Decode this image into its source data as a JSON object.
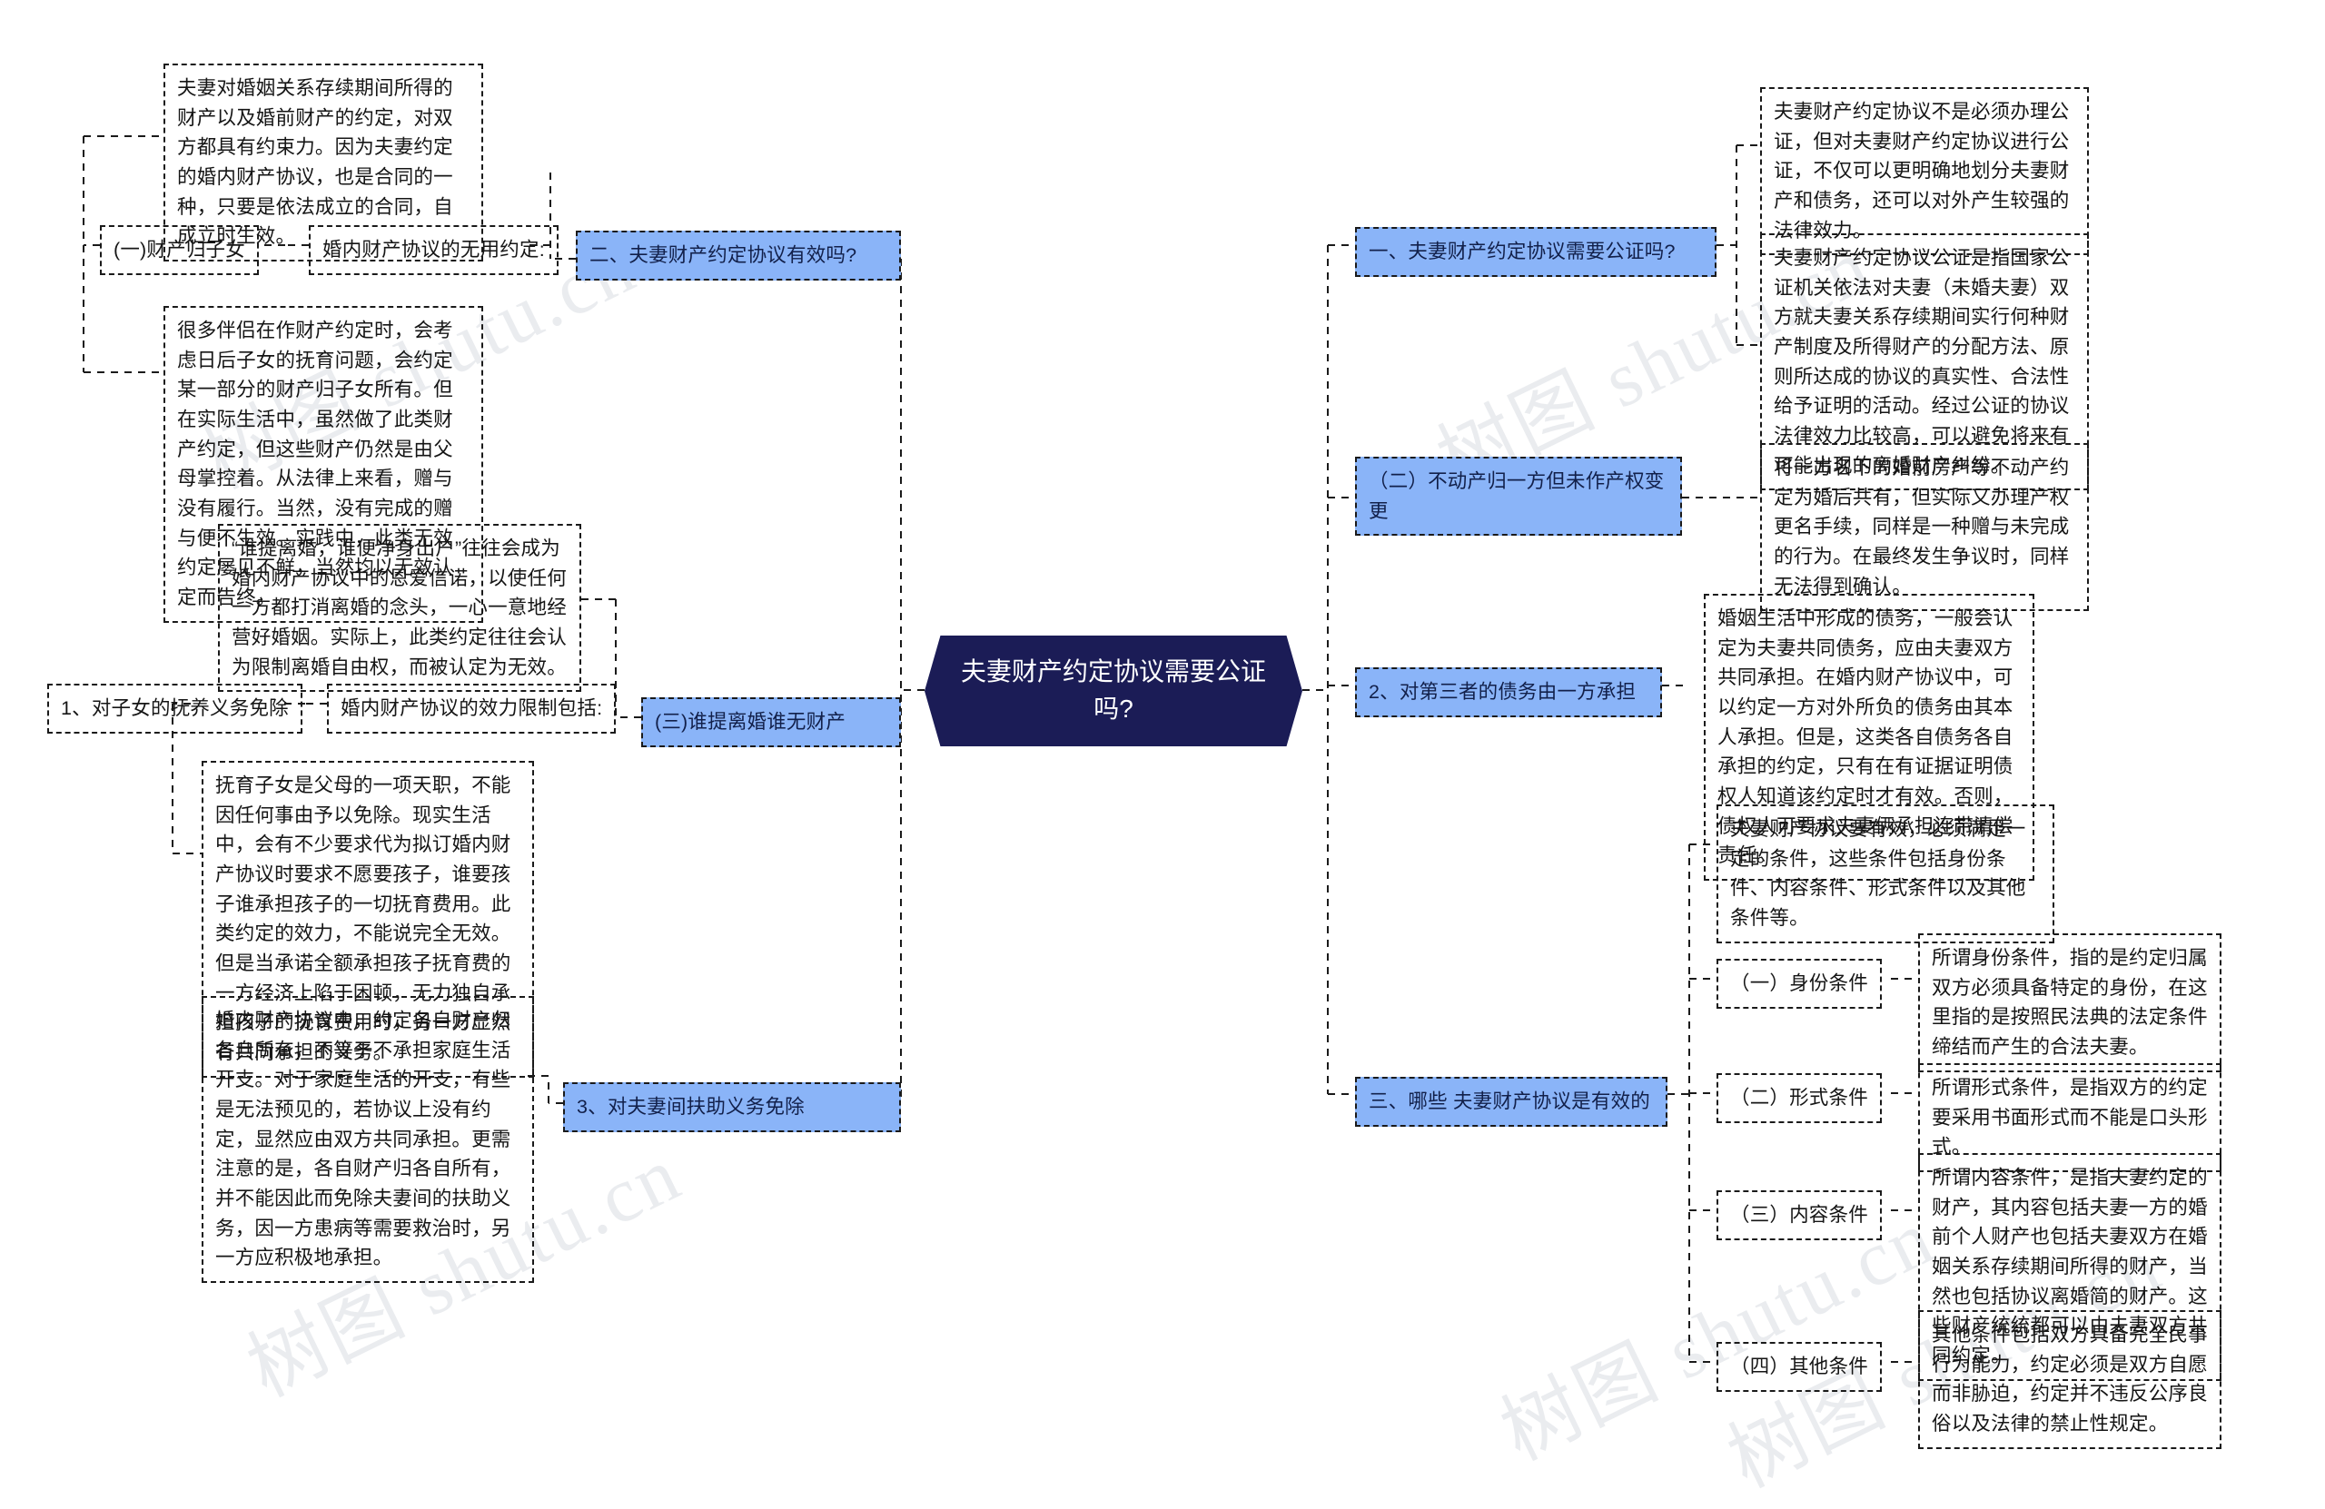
{
  "meta": {
    "watermarks": [
      "树图 shutu.cn",
      "树图 shutu.cn",
      "树图 shutu.cn",
      "树图 shutu.cn",
      "树图 shutu.cn"
    ],
    "accent_blue": "#8ab4f8",
    "center_navy": "#1b1c56",
    "border": "#1a1a1a"
  },
  "center": {
    "title": "夫妻财产约定协议需要公证吗?"
  },
  "left": {
    "branch_b": {
      "topic": "二、夫妻财产约定协议有效吗?",
      "child_label": "婚内财产协议的无用约定:",
      "items": [
        {
          "label": "(一)财产归子女",
          "detail_top": "夫妻对婚姻关系存续期间所得的财产以及婚前财产的约定，对双方都具有约束力。因为夫妻约定的婚内财产协议，也是合同的一种，只要是依法成立的合同，自成立时生效。",
          "detail": "很多伴侣在作财产约定时，会考虑日后子女的抚育问题，会约定某一部分的财产归子女所有。但在实际生活中，虽然做了此类财产约定，但这些财产仍然是由父母掌控着。从法律上来看，赠与没有履行。当然，没有完成的赠与便不生效。实践中，此类无效约定屡见不鲜，当然均以无效认定而告终。"
        }
      ]
    },
    "branch_c": {
      "topic": "(三)谁提离婚谁无财产",
      "detail": "“谁提离婚，谁便净身出户”往往会成为婚内财产协议中的恩爱信诺，以使任何一方都打消离婚的念头，一心一意地经营好婚姻。实际上，此类约定往往会认为限制离婚自由权，而被认定为无效。"
    },
    "branch_d": {
      "group_label": "婚内财产协议的效力限制包括:",
      "item_label": "1、对子女的抚养义务免除",
      "detail": "抚育子女是父母的一项天职，不能因任何事由予以免除。现实生活中，会有不少要求代为拟订婚内财产协议时要求不愿要孩子，谁要孩子谁承担孩子的一切抚育费用。此类约定的效力，不能说完全无效。但是当承诺全额承担孩子抚育费的一方经济上陷于困顿，无力独自承担孩子的抚育费用时，另一方显然有共同承担的义务。"
    },
    "branch_e": {
      "topic": "3、对夫妻间扶助义务免除",
      "detail": "婚内财产协议中，约定各自财产归各自所有，不等于不承担家庭生活开支。对于家庭生活的开支，有些是无法预见的，若协议上没有约定，显然应由双方共同承担。更需注意的是，各自财产归各自所有，并不能因此而免除夫妻间的扶助义务，因一方患病等需要救治时，另一方应积极地承担。"
    }
  },
  "right": {
    "branch_1": {
      "topic": "一、夫妻财产约定协议需要公证吗?",
      "details": [
        "夫妻财产约定协议不是必须办理公证，但对夫妻财产约定协议进行公证，不仅可以更明确地划分夫妻财产和债务，还可以对外产生较强的法律效力。",
        "夫妻财产约定协议公证是指国家公证机关依法对夫妻（未婚夫妻）双方就夫妻关系存续期间实行何种财产制度及所得财产的分配方法、原则所达成的协议的真实性、合法性给予证明的活动。经过公证的协议法律效力比较高，可以避免将来有可能出现的离婚财产纠纷。"
      ]
    },
    "branch_2": {
      "topic": "（二）不动产归一方但未作产权变更",
      "detail": "将一方名下的婚前房产等不动产约定为婚后共有，但实际又办理产权更名手续，同样是一种赠与未完成的行为。在最终发生争议时，同样无法得到确认。"
    },
    "branch_3": {
      "topic": "2、对第三者的债务由一方承担",
      "detail": "婚姻生活中形成的债务，一般会认定为夫妻共同债务，应由夫妻双方共同承担。在婚内财产协议中，可以约定一方对外所负的债务由其本人承担。但是，这类各自债务各自承担的约定，只有在有证据证明债权人知道该约定时才有效。否则，债权人可要求夫妻俩承担连带清偿责任。"
    },
    "branch_4": {
      "topic": "三、哪些 夫妻财产协议是有效的",
      "summary": "夫妻财产协议要有效，必须满足一定的条件，这些条件包括身份条件、内容条件、形式条件以及其他条件等。",
      "conditions": [
        {
          "label": "（一）身份条件",
          "detail": "所谓身份条件，指的是约定归属双方必须具备特定的身份，在这里指的是按照民法典的法定条件缔结而产生的合法夫妻。"
        },
        {
          "label": "（二）形式条件",
          "detail": "所谓形式条件，是指双方的约定要采用书面形式而不能是口头形式。"
        },
        {
          "label": "（三）内容条件",
          "detail": "所谓内容条件，是指夫妻约定的财产，其内容包括夫妻一方的婚前个人财产也包括夫妻双方在婚姻关系存续期间所得的财产，当然也包括协议离婚简的财产。这些财产统统都可以由夫妻双方共同约定。"
        },
        {
          "label": "（四）其他条件",
          "detail": "其他条件包括双方具备完全民事行为能力，约定必须是双方自愿而非胁迫，约定并不违反公序良俗以及法律的禁止性规定。"
        }
      ]
    }
  }
}
